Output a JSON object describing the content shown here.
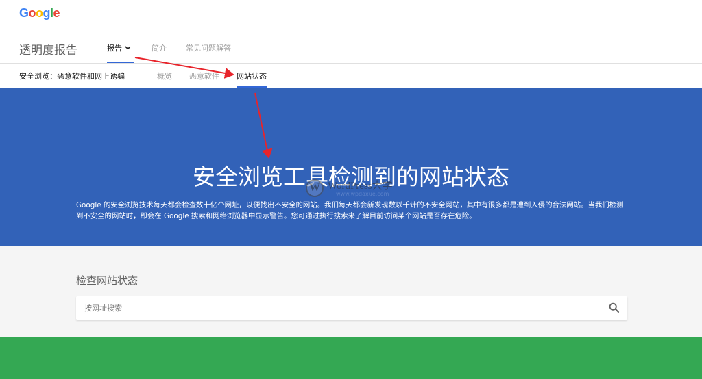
{
  "logo": {
    "letters": [
      "G",
      "o",
      "o",
      "g",
      "l",
      "e"
    ]
  },
  "site": {
    "title": "透明度报告"
  },
  "nav": {
    "tabs": [
      {
        "label": "报告",
        "active": true
      },
      {
        "label": "简介",
        "active": false
      },
      {
        "label": "常见问题解答",
        "active": false
      }
    ],
    "chevron": "chevron-down-icon"
  },
  "subnav": {
    "title": "安全浏览：恶意软件和网上诱骗",
    "tabs": [
      {
        "label": "概览",
        "active": false
      },
      {
        "label": "恶意软件",
        "active": false
      },
      {
        "label": "网站状态",
        "active": true
      }
    ]
  },
  "hero": {
    "title": "安全浏览工具检测到的网站状态",
    "description": "Google 的安全浏览技术每天都会检查数十亿个网址，以便找出不安全的网站。我们每天都会新发现数以千计的不安全网站，其中有很多都是遭到入侵的合法网站。当我们检测到不安全的网站时，即会在 Google 搜索和网络浏览器中显示警告。您可通过执行搜索来了解目前访问某个网站是否存在危险。"
  },
  "watermark": {
    "logo_letter": "W",
    "text": "WordPress大学",
    "url": "www.wpdaxue.com"
  },
  "check": {
    "title": "检查网站状态",
    "search_placeholder": "按网址搜索",
    "search_icon": "search-icon"
  },
  "colors": {
    "hero_bg": "#3262b8",
    "accent": "#3367d6",
    "green_band": "#34a853",
    "annotation_arrow": "#e8242b"
  }
}
